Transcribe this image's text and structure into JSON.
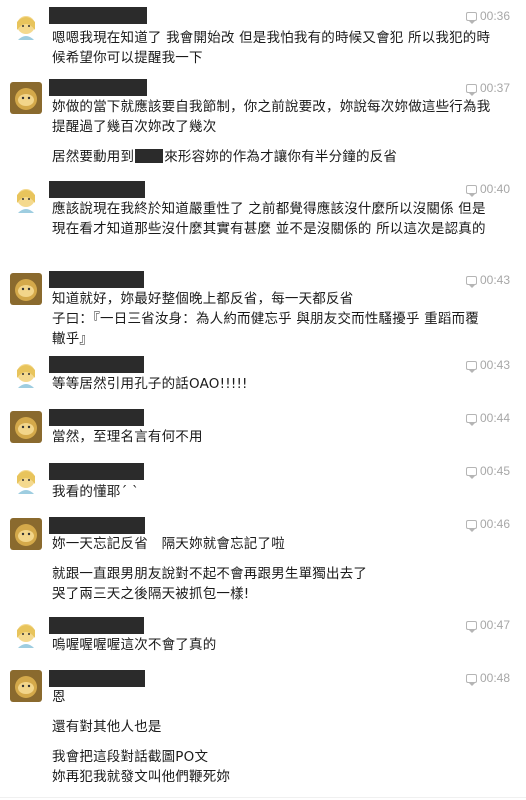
{
  "colors": {
    "redaction": "#2b2b2b",
    "timestamp": "#a7a7a7",
    "text": "#1a1a1a"
  },
  "messages": [
    {
      "sender": "girl",
      "time": "00:36",
      "lines": [
        "嗯嗯我現在知道了 我會開始改 但是我怕我有的時候又會犯 所以我犯的時候希望你可以提醒我一下"
      ]
    },
    {
      "sender": "boy",
      "time": "00:37",
      "paragraphs": [
        "妳做的當下就應該要自我節制，你之前說要改，妳說每次妳做這些行為我提醒過了幾百次妳改了幾次"
      ],
      "p2_before": "居然要動用到",
      "p2_after": "來形容妳的作為才讓你有半分鐘的反省"
    },
    {
      "sender": "girl",
      "time": "00:40",
      "lines": [
        "應該說現在我終於知道嚴重性了 之前都覺得應該沒什麼所以沒關係 但是現在看才知道那些沒什麼其實有甚麼 並不是沒關係的 所以這次是認真的"
      ]
    },
    {
      "sender": "boy",
      "time": "00:43",
      "lines": [
        "知道就好，妳最好整個晚上都反省，每一天都反省",
        "子曰：『一日三省汝身：為人約而健忘乎 與朋友交而性騷擾乎 重蹈而覆轍乎』"
      ]
    },
    {
      "sender": "girl",
      "time": "00:43",
      "lines": [
        "等等居然引用孔子的話OAO!!!!!"
      ]
    },
    {
      "sender": "boy",
      "time": "00:44",
      "lines": [
        "當然，至理名言有何不用"
      ]
    },
    {
      "sender": "girl",
      "time": "00:45",
      "lines": [
        "我看的懂耶´ ˋ"
      ]
    },
    {
      "sender": "boy",
      "time": "00:46",
      "paragraphs": [
        "妳一天忘記反省　隔天妳就會忘記了啦",
        "就跟一直跟男朋友說對不起不會再跟男生單獨出去了\n哭了兩三天之後隔天被抓包一樣!"
      ]
    },
    {
      "sender": "girl",
      "time": "00:47",
      "lines": [
        "嗚喔喔喔喔這次不會了真的"
      ]
    },
    {
      "sender": "boy",
      "time": "00:48",
      "paragraphs": [
        "恩",
        "還有對其他人也是",
        "我會把這段對話截圖PO文\n妳再犯我就發文叫他們鞭死妳"
      ]
    }
  ]
}
